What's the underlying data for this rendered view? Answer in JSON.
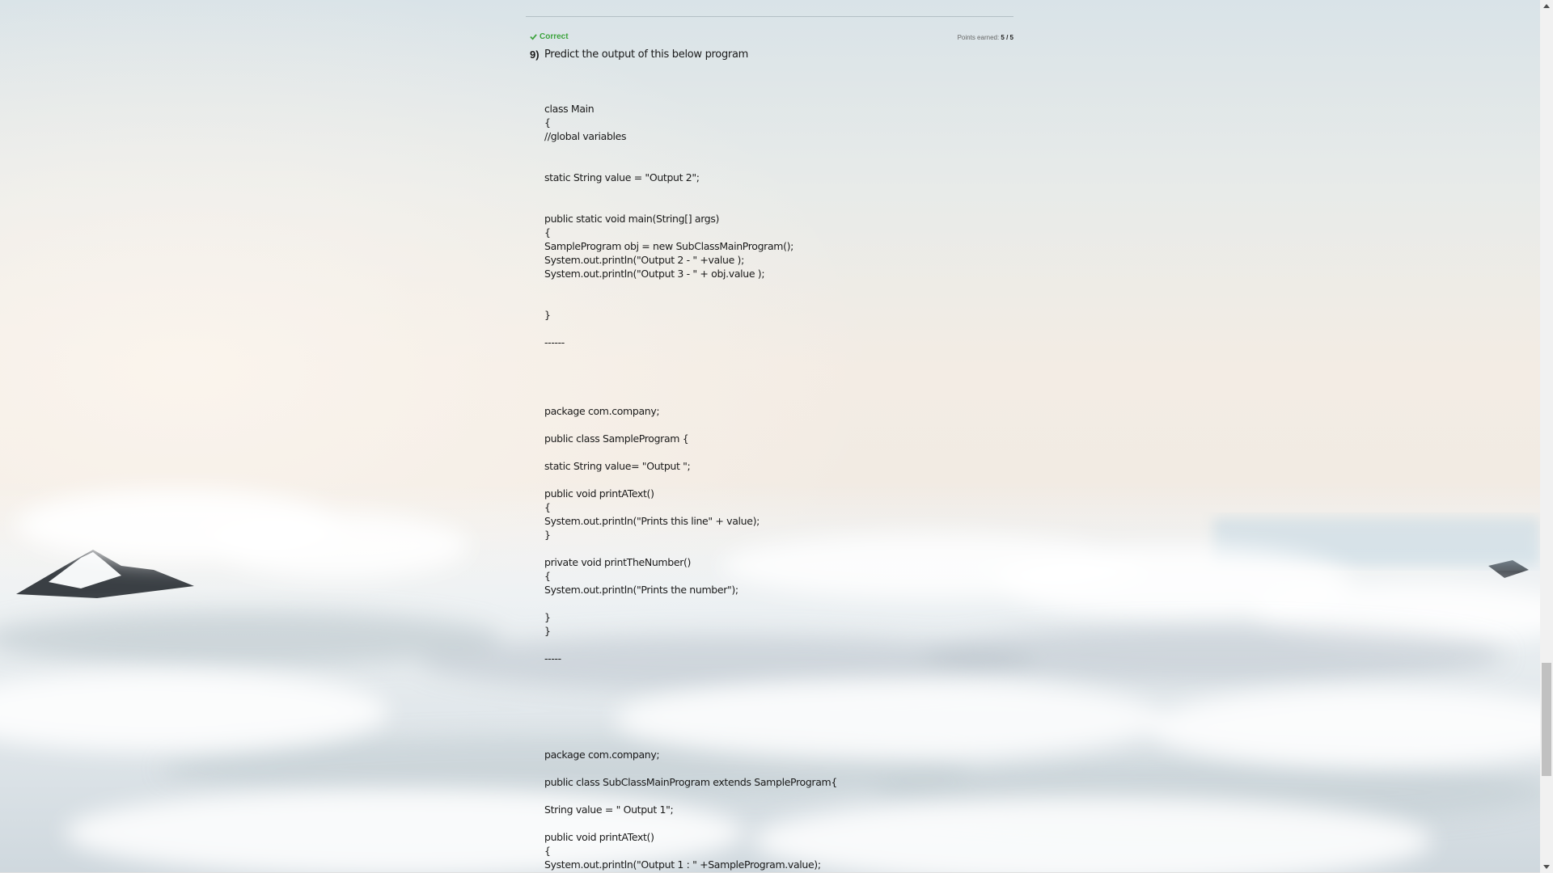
{
  "question": {
    "status": "Correct",
    "points_label": "Points earned:",
    "points_value": "5 / 5",
    "number": "9)",
    "prompt": "Predict the output of this below program"
  },
  "code": [
    "class Main",
    "{",
    "//global variables",
    "static String value = \"Output 2\";",
    "public static void main(String[] args)",
    "{",
    "SampleProgram obj = new SubClassMainProgram();",
    "System.out.println(\"Output 2 - \" +value );",
    "System.out.println(\"Output 3 - \" + obj.value );",
    "}",
    "------",
    "package com.company;",
    "public class SampleProgram {",
    "static String value= \"Output \";",
    "public void printAText()",
    "{",
    "System.out.println(\"Prints this line\" + value);",
    "}",
    "private void printTheNumber()",
    "{",
    "System.out.println(\"Prints the number\");",
    "}",
    "}",
    "-----",
    "package com.company;",
    "public class SubClassMainProgram extends SampleProgram{",
    "String value = \" Output 1\";",
    "public void printAText()",
    "{",
    "System.out.println(\"Output 1 : \" +SampleProgram.value);"
  ],
  "icons": {
    "status": "check-icon",
    "scroll_up": "arrow-up-icon",
    "scroll_down": "arrow-down-icon"
  },
  "colors": {
    "correct": "#3da33d"
  }
}
